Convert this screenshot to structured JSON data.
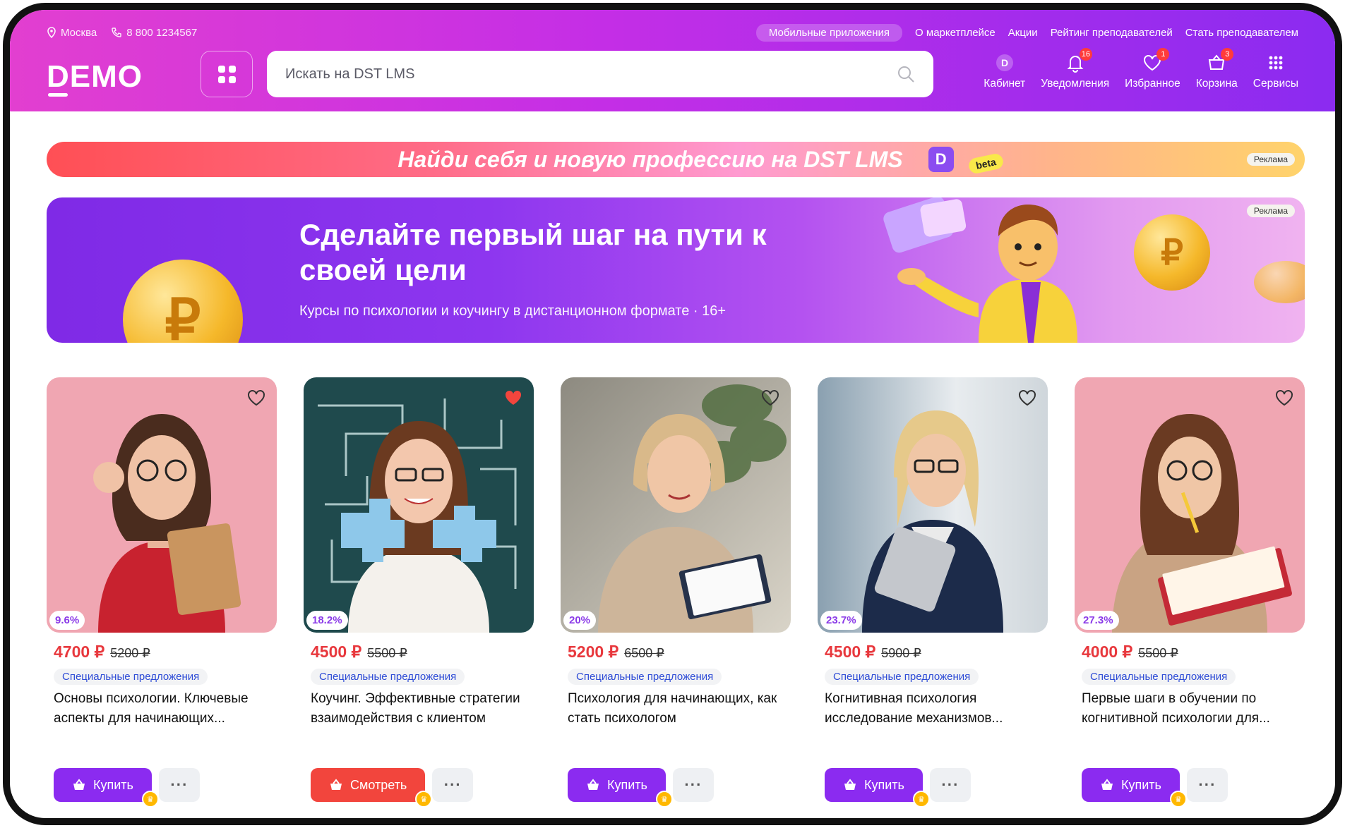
{
  "topbar": {
    "city": "Москва",
    "phone": "8 800 1234567",
    "links": [
      "Мобильные приложения",
      "О маркетплейсе",
      "Акции",
      "Рейтинг преподавателей",
      "Стать преподавателем"
    ]
  },
  "logo": "DEMO",
  "search": {
    "placeholder": "Искать на DST LMS"
  },
  "nav": [
    {
      "label": "Кабинет",
      "icon": "cabinet-icon",
      "badge": ""
    },
    {
      "label": "Уведомления",
      "icon": "bell-icon",
      "badge": "16"
    },
    {
      "label": "Избранное",
      "icon": "heart-icon",
      "badge": "1"
    },
    {
      "label": "Корзина",
      "icon": "basket-icon",
      "badge": "3"
    },
    {
      "label": "Сервисы",
      "icon": "grid-icon",
      "badge": ""
    }
  ],
  "promo": {
    "text": "Найди себя и новую профессию на DST LMS",
    "beta": "beta",
    "ad": "Реклама",
    "logo": "D"
  },
  "hero": {
    "title": "Сделайте первый шаг на пути к своей цели",
    "subtitle": "Курсы по психологии и коучингу в дистанционном формате · 16+",
    "ad": "Реклама"
  },
  "cards": [
    {
      "discount": "9.6%",
      "price": "4700 ₽",
      "old": "5200 ₽",
      "tag": "Специальные предложения",
      "title": "Основы психологии. Ключевые аспекты для начинающих...",
      "button": "Купить",
      "liked": false
    },
    {
      "discount": "18.2%",
      "price": "4500 ₽",
      "old": "5500 ₽",
      "tag": "Специальные предложения",
      "title": "Коучинг. Эффективные стратегии взаимодействия с клиентом",
      "button": "Смотреть",
      "liked": true
    },
    {
      "discount": "20%",
      "price": "5200 ₽",
      "old": "6500 ₽",
      "tag": "Специальные предложения",
      "title": "Психология для начинающих, как стать психологом",
      "button": "Купить",
      "liked": false
    },
    {
      "discount": "23.7%",
      "price": "4500 ₽",
      "old": "5900 ₽",
      "tag": "Специальные предложения",
      "title": "Когнитивная психология исследование механизмов...",
      "button": "Купить",
      "liked": false
    },
    {
      "discount": "27.3%",
      "price": "4000 ₽",
      "old": "5500 ₽",
      "tag": "Специальные предложения",
      "title": "Первые шаги в обучении по когнитивной психологии для...",
      "button": "Купить",
      "liked": false
    }
  ],
  "colors": {
    "accent": "#8b2bf0",
    "danger": "#f2453d",
    "price": "#e8383d"
  }
}
